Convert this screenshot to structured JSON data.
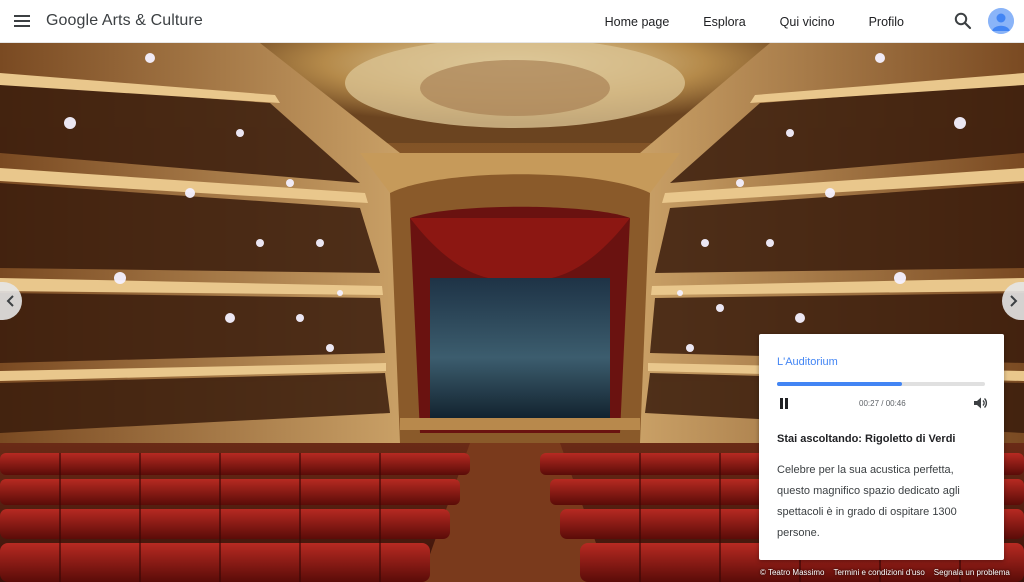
{
  "header": {
    "brand": "Google Arts & Culture",
    "nav": [
      {
        "label": "Home page"
      },
      {
        "label": "Esplora"
      },
      {
        "label": "Qui vicino"
      },
      {
        "label": "Profilo"
      }
    ]
  },
  "audio_card": {
    "title": "L'Auditorium",
    "progress_fraction": 0.6,
    "time": "00:27 / 00:46",
    "now_playing": "Stai ascoltando: Rigoletto di Verdi",
    "description": "Celebre per la sua acustica perfetta, questo magnifico spazio dedicato agli spettacoli è in grado di ospitare 1300 persone."
  },
  "footer": {
    "credit": "© Teatro Massimo",
    "terms": "Termini e condizioni d'uso",
    "report": "Segnala un problema"
  },
  "colors": {
    "accent": "#4285f4",
    "text": "#202124"
  },
  "icons": {
    "menu": "menu-icon",
    "search": "search-icon",
    "avatar": "avatar-icon",
    "prev": "chevron-left-icon",
    "next": "chevron-right-icon",
    "pause": "pause-icon",
    "volume": "volume-icon"
  }
}
